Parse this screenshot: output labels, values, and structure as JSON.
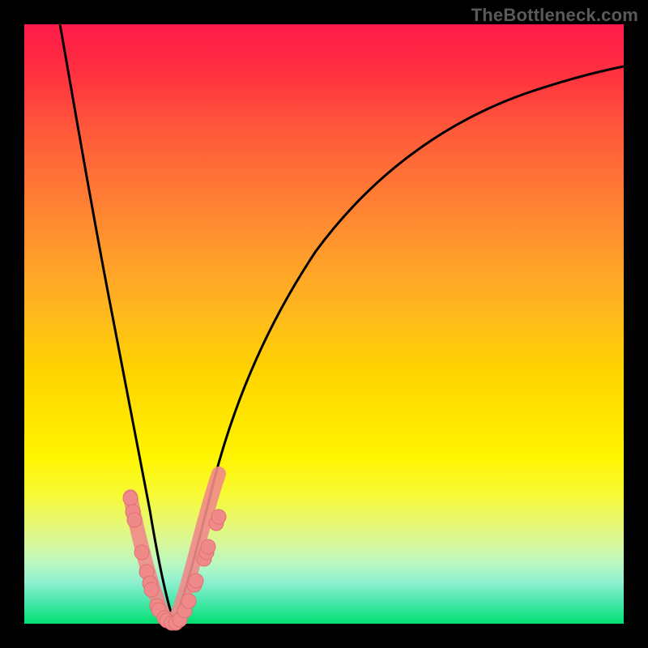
{
  "watermark": "TheBottleneck.com",
  "chart_data": {
    "type": "line",
    "title": "",
    "xlabel": "",
    "ylabel": "",
    "xlim": [
      0,
      100
    ],
    "ylim": [
      0,
      100
    ],
    "grid": false,
    "series": [
      {
        "name": "left-curve",
        "x": [
          6,
          8,
          10,
          12,
          14,
          16,
          18,
          20,
          22,
          23,
          24,
          25
        ],
        "values": [
          100,
          82,
          66,
          51,
          38,
          27,
          17,
          9,
          3,
          1,
          0,
          0
        ]
      },
      {
        "name": "right-curve",
        "x": [
          25,
          26,
          28,
          30,
          33,
          36,
          40,
          45,
          50,
          56,
          63,
          71,
          80,
          90,
          100
        ],
        "values": [
          0,
          1,
          5,
          10,
          17,
          24,
          33,
          42,
          50,
          58,
          66,
          73,
          80,
          86,
          91
        ]
      },
      {
        "name": "left-markers",
        "x": [
          17.5,
          18.0,
          18.2,
          19.5,
          20.3,
          20.8,
          21.0,
          22.0,
          22.3,
          23.2,
          23.5,
          24.3,
          25.0
        ],
        "values": [
          21,
          18,
          17,
          11,
          8,
          6,
          5,
          2.5,
          2,
          0.8,
          0.5,
          0.1,
          0
        ]
      },
      {
        "name": "right-markers",
        "x": [
          25.6,
          26.4,
          27.0,
          28.0,
          28.3,
          29.6,
          30.0,
          30.3,
          31.8,
          32.2
        ],
        "values": [
          0.5,
          2,
          3.5,
          6,
          6.6,
          10,
          11,
          12,
          16,
          17
        ]
      }
    ],
    "colors": {
      "curve": "#000000",
      "marker_fill": "#f08a8a",
      "marker_stroke": "#e07070"
    }
  }
}
